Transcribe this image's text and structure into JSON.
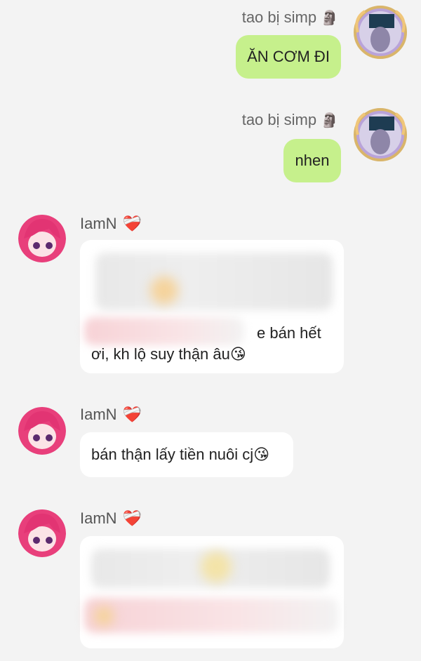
{
  "messages": [
    {
      "sender": "tao bị simp",
      "sender_emoji": "🗿",
      "text": "ĂN CƠM ĐI",
      "direction": "outgoing"
    },
    {
      "sender": "tao bị simp",
      "sender_emoji": "🗿",
      "text": "nhen",
      "direction": "outgoing"
    },
    {
      "sender": "IamN",
      "sender_badge": "❤️‍🩹",
      "text_line1": "e bán hết",
      "text_line2": "ơi, kh lộ suy thận âu",
      "emoji": "😘",
      "direction": "incoming",
      "partially_blurred": true
    },
    {
      "sender": "IamN",
      "sender_badge": "❤️‍🩹",
      "text": "bán thận lấy tiền nuôi cj",
      "emoji": "😘",
      "direction": "incoming"
    },
    {
      "sender": "IamN",
      "sender_badge": "❤️‍🩹",
      "direction": "incoming",
      "blurred": true
    }
  ],
  "colors": {
    "background": "#f3f3f3",
    "outgoing_bubble": "#c6f08c",
    "incoming_bubble": "#ffffff",
    "avatar_pink": "#e83f7b"
  }
}
